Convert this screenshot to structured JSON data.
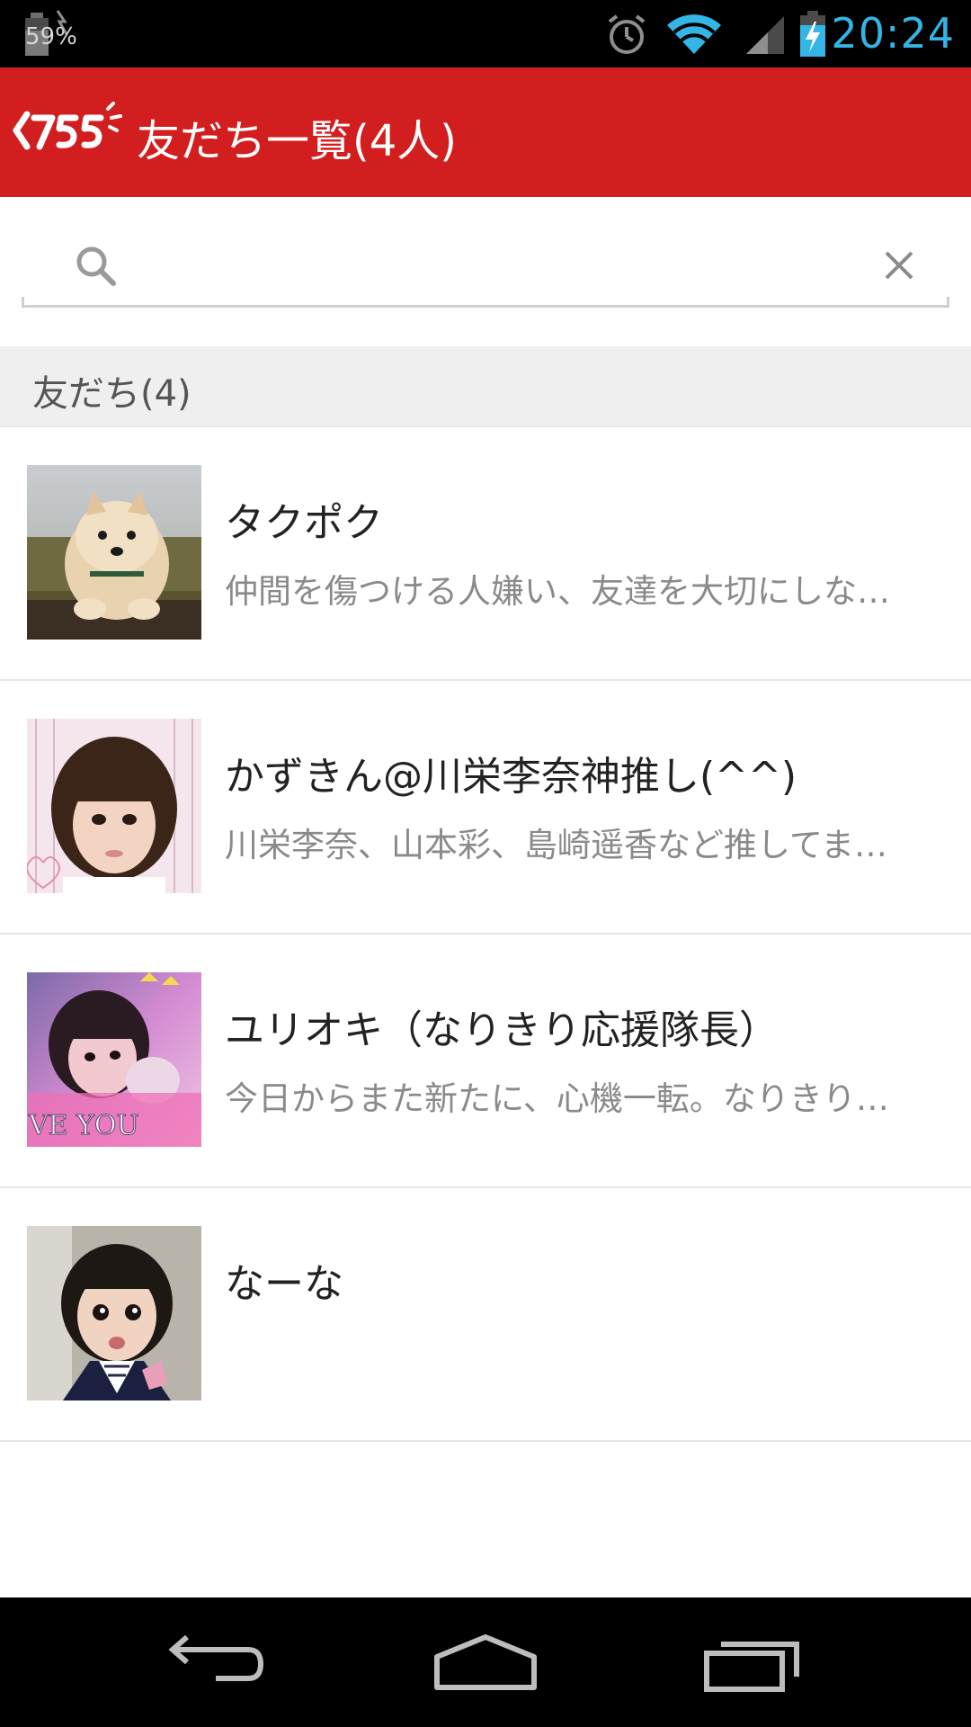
{
  "status_bar": {
    "battery_percent": "59%",
    "time": "20:24",
    "icons": [
      "battery-icon",
      "alarm-icon",
      "wifi-icon",
      "signal-icon",
      "battery-charging-icon"
    ]
  },
  "app_bar": {
    "logo_text": "755",
    "title": "友だち一覧(4人)"
  },
  "search": {
    "value": "",
    "placeholder": ""
  },
  "section": {
    "title": "友だち(4)"
  },
  "friends": [
    {
      "name": "タクポク",
      "status": "仲間を傷つける人嫌い、友達を大切にしな…",
      "avatar": "dog-photo"
    },
    {
      "name": "かずきん@川栄李奈神推し(^^)",
      "status": "川栄李奈、山本彩、島崎遥香など推してま…",
      "avatar": "person-photo"
    },
    {
      "name": "ユリオキ（なりきり応援隊長）",
      "status": "今日からまた新たに、心機一転。なりきり…",
      "avatar": "person-photo",
      "avatar_overlay_text": "VE YOU"
    },
    {
      "name": "なーな",
      "status": "",
      "avatar": "person-photo"
    }
  ],
  "colors": {
    "app_bar": "#d21e1e",
    "clock": "#33b5e5",
    "section_bg": "#efefef"
  },
  "nav_bar": {
    "buttons": [
      "back-icon",
      "home-icon",
      "recents-icon"
    ]
  }
}
